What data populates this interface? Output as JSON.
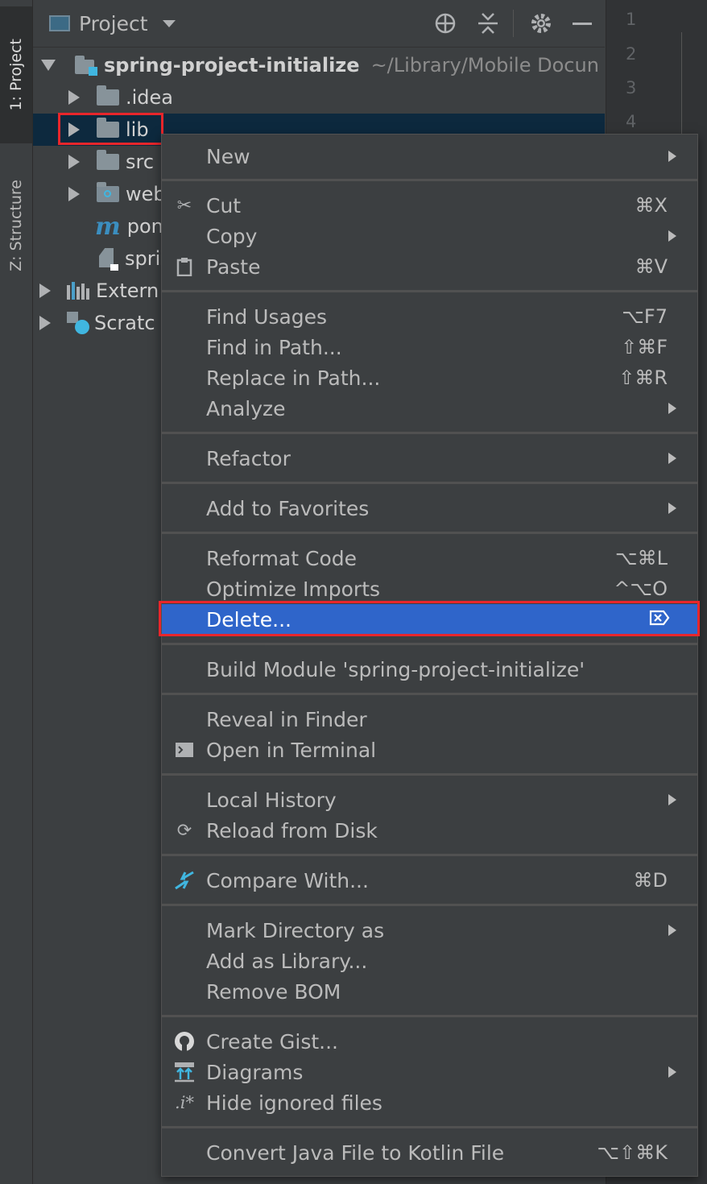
{
  "tool_window_tabs": [
    {
      "label": "1: Project"
    },
    {
      "label": "Z: Structure"
    }
  ],
  "project_panel": {
    "title": "Project",
    "tree": [
      {
        "label": "spring-project-initialize",
        "path": "~/Library/Mobile Docun",
        "expanded": true
      },
      {
        "label": ".idea"
      },
      {
        "label": "lib",
        "selected": true
      },
      {
        "label": "src"
      },
      {
        "label": "web"
      },
      {
        "label": "pon"
      },
      {
        "label": "spri"
      },
      {
        "label": "Extern"
      },
      {
        "label": "Scratc"
      }
    ]
  },
  "editor": {
    "line_numbers": [
      "1",
      "2",
      "3",
      "4"
    ]
  },
  "context_menu": {
    "items": [
      {
        "label": "New",
        "submenu": true
      },
      {
        "label": "Cut",
        "shortcut": "⌘X",
        "icon": "scissors-icon"
      },
      {
        "label": "Copy",
        "submenu": true
      },
      {
        "label": "Paste",
        "shortcut": "⌘V",
        "icon": "clipboard-icon"
      },
      {
        "label": "Find Usages",
        "shortcut": "⌥F7"
      },
      {
        "label": "Find in Path...",
        "shortcut": "⇧⌘F"
      },
      {
        "label": "Replace in Path...",
        "shortcut": "⇧⌘R"
      },
      {
        "label": "Analyze",
        "submenu": true
      },
      {
        "label": "Refactor",
        "submenu": true
      },
      {
        "label": "Add to Favorites",
        "submenu": true
      },
      {
        "label": "Reformat Code",
        "shortcut": "⌥⌘L"
      },
      {
        "label": "Optimize Imports",
        "shortcut": "^⌥O"
      },
      {
        "label": "Delete...",
        "shortcut": "⌦",
        "highlighted": true
      },
      {
        "label": "Build Module 'spring-project-initialize'"
      },
      {
        "label": "Reveal in Finder"
      },
      {
        "label": "Open in Terminal",
        "icon": "terminal-icon"
      },
      {
        "label": "Local History",
        "submenu": true
      },
      {
        "label": "Reload from Disk",
        "icon": "reload-icon"
      },
      {
        "label": "Compare With...",
        "shortcut": "⌘D",
        "icon": "compare-icon"
      },
      {
        "label": "Mark Directory as",
        "submenu": true
      },
      {
        "label": "Add as Library..."
      },
      {
        "label": "Remove BOM"
      },
      {
        "label": "Create Gist...",
        "icon": "github-icon"
      },
      {
        "label": "Diagrams",
        "submenu": true,
        "icon": "diagram-icon"
      },
      {
        "label": "Hide ignored files",
        "icon": "ignored-files-icon"
      },
      {
        "label": "Convert Java File to Kotlin File",
        "shortcut": "⌥⇧⌘K"
      }
    ]
  },
  "colors": {
    "highlight": "#2f65ca",
    "annotation_border": "#e8262b",
    "selection": "#0d293e"
  }
}
